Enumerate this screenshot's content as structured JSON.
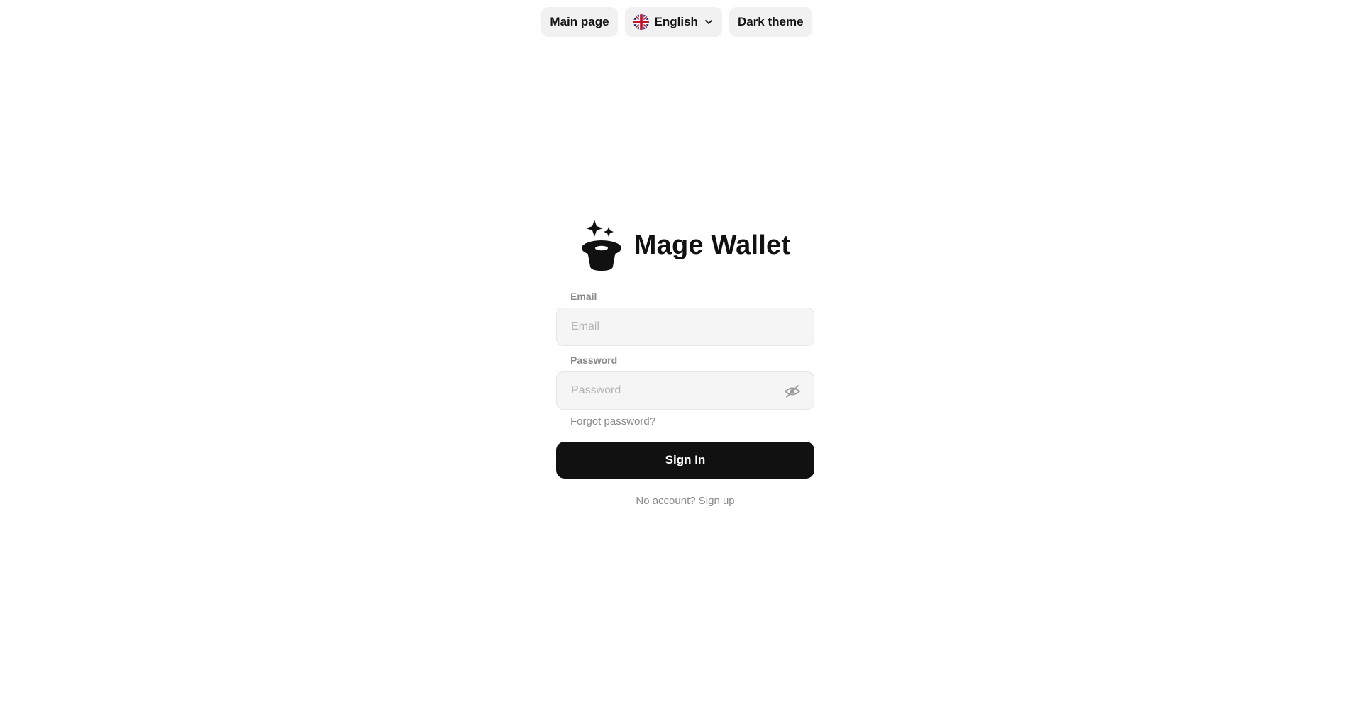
{
  "header": {
    "main_page_label": "Main page",
    "language": {
      "selected": "English",
      "flag_icon": "uk-flag-icon",
      "dropdown_icon": "chevron-down-icon"
    },
    "theme_label": "Dark theme"
  },
  "brand": {
    "logo_icon": "magic-hat-icon",
    "name": "Mage Wallet"
  },
  "form": {
    "email": {
      "label": "Email",
      "placeholder": "Email",
      "value": ""
    },
    "password": {
      "label": "Password",
      "placeholder": "Password",
      "value": "",
      "toggle_icon": "eye-off-icon"
    },
    "forgot_label": "Forgot password?",
    "submit_label": "Sign In",
    "no_account_text": "No account?",
    "signup_label": "Sign up"
  },
  "colors": {
    "primary_button": "#111111",
    "muted_text": "#8a8a8a",
    "input_bg": "#f5f5f5",
    "pill_bg": "#f1f1f1"
  }
}
